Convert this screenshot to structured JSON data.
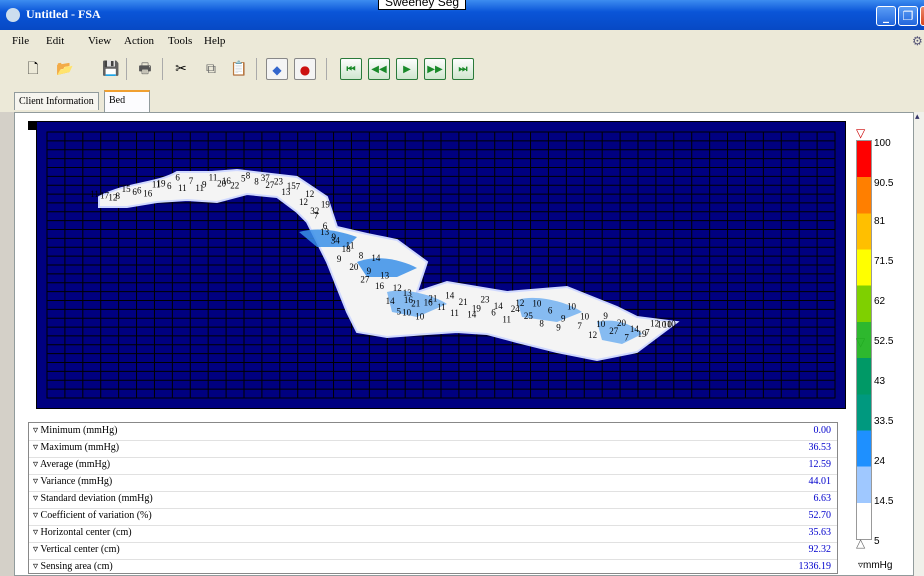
{
  "window": {
    "title": "Untitled - FSA",
    "caption_overlay": "Sweeney Seg",
    "minimize": "_",
    "maximize": "❐",
    "close": "✕"
  },
  "menu": [
    "File",
    "Edit",
    "View",
    "Action",
    "Tools",
    "Help"
  ],
  "toolbar": {
    "new_icon": "document-new-icon",
    "open_icon": "folder-open-icon",
    "save_icon": "floppy-disk-icon",
    "print_icon": "printer-icon",
    "cut_icon": "scissors-icon",
    "copy_icon": "copy-icon",
    "paste_icon": "paste-icon",
    "diamond_icon": "diamond-icon",
    "record_icon": "record-icon",
    "first_label": "⏮",
    "prev_label": "◀◀",
    "play_label": "▶",
    "next_label": "▶▶",
    "last_label": "⏭"
  },
  "tabs": [
    "Client Information",
    "Bed"
  ],
  "active_tab": "Bed",
  "stats": [
    {
      "label": "▿ Minimum (mmHg)",
      "value": "0.00"
    },
    {
      "label": "▿ Maximum (mmHg)",
      "value": "36.53"
    },
    {
      "label": "▿ Average (mmHg)",
      "value": "12.59"
    },
    {
      "label": "▿ Variance (mmHg)",
      "value": "44.01"
    },
    {
      "label": "▿ Standard deviation (mmHg)",
      "value": "6.63"
    },
    {
      "label": "▿ Coefficient of variation (%)",
      "value": "52.70"
    },
    {
      "label": "▿ Horizontal center (cm)",
      "value": "35.63"
    },
    {
      "label": "▿ Vertical center (cm)",
      "value": "92.32"
    },
    {
      "label": "▿ Sensing area (cm)",
      "value": "1336.19"
    }
  ],
  "color_scale": {
    "labels": [
      "100",
      "90.5",
      "81",
      "71.5",
      "62",
      "52.5",
      "43",
      "33.5",
      "24",
      "14.5",
      "5"
    ],
    "colors": [
      "#ff0000",
      "#ff7f00",
      "#ffbf00",
      "#ffff00",
      "#7fd000",
      "#2eb82e",
      "#009966",
      "#00997f",
      "#1e90ff",
      "#9fc8ff",
      "#ffffff"
    ],
    "unit": "▿mmHg"
  },
  "heatmap": {
    "cells": [
      {
        "text": "11",
        "v": 11
      },
      {
        "text": "17",
        "v": 17
      },
      {
        "text": "8",
        "v": 8
      },
      {
        "text": "12",
        "v": 12
      },
      {
        "text": "15",
        "v": 15
      },
      {
        "text": "6",
        "v": 6
      },
      {
        "text": "6",
        "v": 6
      },
      {
        "text": "16",
        "v": 16
      },
      {
        "text": "19",
        "v": 19
      },
      {
        "text": "11",
        "v": 11
      },
      {
        "text": "6",
        "v": 6
      },
      {
        "text": "11",
        "v": 11
      },
      {
        "text": "6",
        "v": 6
      },
      {
        "text": "7",
        "v": 7
      },
      {
        "text": "9",
        "v": 9
      },
      {
        "text": "11",
        "v": 11
      },
      {
        "text": "11",
        "v": 11
      },
      {
        "text": "16",
        "v": 16
      },
      {
        "text": "20",
        "v": 20
      },
      {
        "text": "22",
        "v": 22
      },
      {
        "text": "8",
        "v": 8
      },
      {
        "text": "5",
        "v": 5
      },
      {
        "text": "8",
        "v": 8
      },
      {
        "text": "27",
        "v": 27
      },
      {
        "text": "37",
        "v": 37
      },
      {
        "text": "23",
        "v": 23
      },
      {
        "text": "15",
        "v": 15
      },
      {
        "text": "13",
        "v": 13
      },
      {
        "text": "7",
        "v": 7
      },
      {
        "text": "12",
        "v": 12
      },
      {
        "text": "12",
        "v": 12
      },
      {
        "text": "32",
        "v": 32
      },
      {
        "text": "19",
        "v": 19
      },
      {
        "text": "7",
        "v": 7
      },
      {
        "text": "6",
        "v": 6
      },
      {
        "text": "9",
        "v": 9
      },
      {
        "text": "13",
        "v": 13
      },
      {
        "text": "34",
        "v": 34
      },
      {
        "text": "18",
        "v": 18
      },
      {
        "text": "9",
        "v": 9
      },
      {
        "text": "11",
        "v": 11
      },
      {
        "text": "8",
        "v": 8
      },
      {
        "text": "20",
        "v": 20
      },
      {
        "text": "27",
        "v": 27
      },
      {
        "text": "14",
        "v": 14
      },
      {
        "text": "9",
        "v": 9
      },
      {
        "text": "16",
        "v": 16
      },
      {
        "text": "14",
        "v": 14
      },
      {
        "text": "13",
        "v": 13
      },
      {
        "text": "12",
        "v": 12
      },
      {
        "text": "16",
        "v": 16
      },
      {
        "text": "5",
        "v": 5
      },
      {
        "text": "13",
        "v": 13
      },
      {
        "text": "21",
        "v": 21
      },
      {
        "text": "10",
        "v": 10
      },
      {
        "text": "10",
        "v": 10
      },
      {
        "text": "21",
        "v": 21
      },
      {
        "text": "16",
        "v": 16
      },
      {
        "text": "11",
        "v": 11
      },
      {
        "text": "11",
        "v": 11
      },
      {
        "text": "14",
        "v": 14
      },
      {
        "text": "21",
        "v": 21
      },
      {
        "text": "19",
        "v": 19
      },
      {
        "text": "14",
        "v": 14
      },
      {
        "text": "23",
        "v": 23
      },
      {
        "text": "14",
        "v": 14
      },
      {
        "text": "6",
        "v": 6
      },
      {
        "text": "11",
        "v": 11
      },
      {
        "text": "12",
        "v": 12
      },
      {
        "text": "24",
        "v": 24
      },
      {
        "text": "25",
        "v": 25
      },
      {
        "text": "8",
        "v": 8
      },
      {
        "text": "10",
        "v": 10
      },
      {
        "text": "6",
        "v": 6
      },
      {
        "text": "9",
        "v": 9
      },
      {
        "text": "9",
        "v": 9
      },
      {
        "text": "10",
        "v": 10
      },
      {
        "text": "10",
        "v": 10
      },
      {
        "text": "7",
        "v": 7
      },
      {
        "text": "12",
        "v": 12
      },
      {
        "text": "9",
        "v": 9
      },
      {
        "text": "10",
        "v": 10
      },
      {
        "text": "27",
        "v": 27
      },
      {
        "text": "7",
        "v": 7
      },
      {
        "text": "20",
        "v": 20
      },
      {
        "text": "14",
        "v": 14
      },
      {
        "text": "7",
        "v": 7
      },
      {
        "text": "19",
        "v": 19
      },
      {
        "text": "12",
        "v": 12
      },
      {
        "text": "10",
        "v": 10
      },
      {
        "text": "10",
        "v": 10
      },
      {
        "text": "10",
        "v": 10
      }
    ]
  }
}
